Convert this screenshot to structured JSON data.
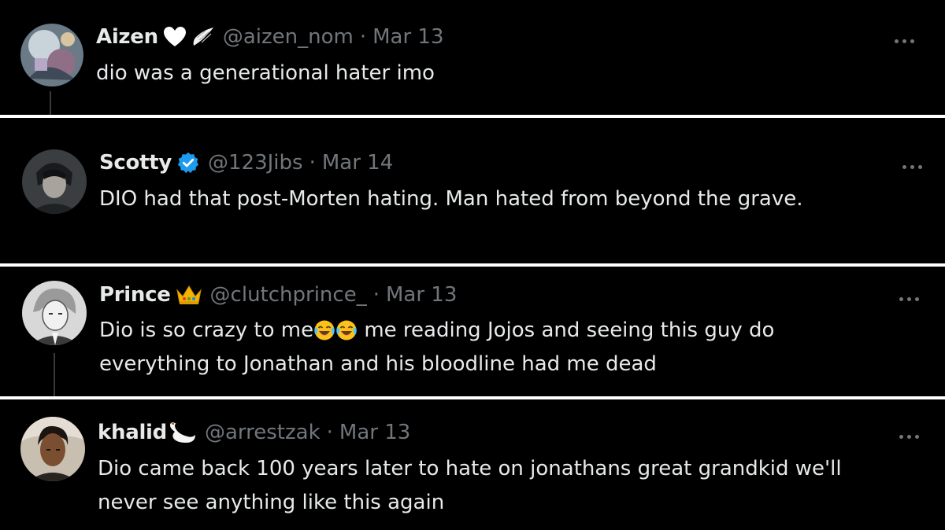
{
  "tweets": [
    {
      "name": "Aizen",
      "handle": "@aizen_nom",
      "separator": "·",
      "date": "Mar 13",
      "text_lines": [
        "dio was a generational hater imo"
      ]
    },
    {
      "name": "Scotty",
      "handle": "@123Jibs",
      "separator": "·",
      "date": "Mar 14",
      "text_lines": [
        "DIO had that post-Morten hating. Man hated from beyond the grave."
      ]
    },
    {
      "name": "Prince",
      "handle": "@clutchprince_",
      "separator": "·",
      "date": "Mar 13",
      "text_lines": [
        "Dio is so crazy to me",
        " me reading Jojos and seeing this guy do",
        "everything to Jonathan and his bloodline had me dead"
      ]
    },
    {
      "name": "khalid",
      "handle": "@arrestzak",
      "separator": "·",
      "date": "Mar 13",
      "text_lines": [
        "Dio came back 100 years later to hate on jonathans great grandkid we'll",
        "never see anything like this again"
      ]
    }
  ],
  "icons": {
    "name_badges": [
      "white-heart-icon",
      "angel-wing-icon",
      "verified-badge-icon",
      "crown-icon",
      "swan-icon"
    ],
    "emoji": [
      "face-with-tears-of-joy-icon",
      "face-with-tears-of-joy-icon"
    ],
    "more": "more-options-icon"
  },
  "colors": {
    "background": "#000000",
    "divider": "#ffffff",
    "primary_text": "#e7e9ea",
    "secondary_text": "#71767b",
    "verified_blue": "#1d9bf0"
  }
}
